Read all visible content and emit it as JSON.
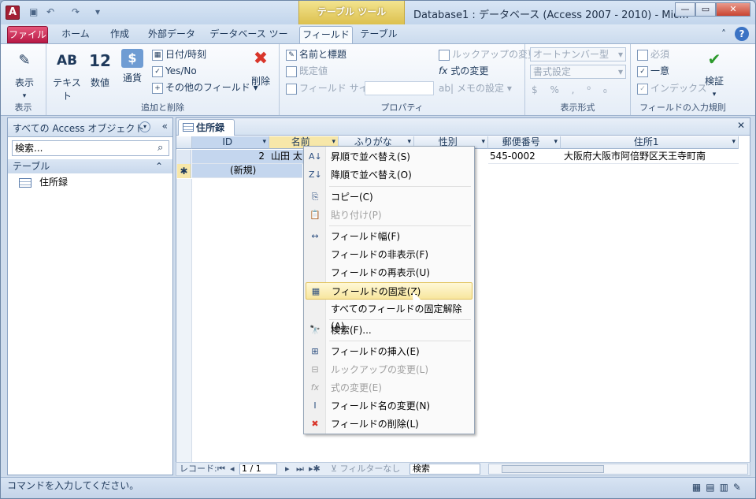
{
  "title": "Database1 : データベース (Access 2007 - 2010)  -  Mic...",
  "app_icon": "A",
  "context_tools": "テーブル ツール",
  "tabs": [
    "ファイル",
    "ホーム",
    "作成",
    "外部データ",
    "データベース ツール",
    "フィールド",
    "テーブル"
  ],
  "ribbon": {
    "view_label": "表示",
    "group_view": "表示",
    "text_label": "テキスト",
    "number_label": "数値",
    "currency_label": "通貨",
    "date_label": "日付/時刻",
    "yesno_label": "Yes/No",
    "more_fields": "その他のフィールド",
    "delete_label": "削除",
    "group_add": "追加と削除",
    "name_caption": "名前と標題",
    "default_value": "既定値",
    "field_size": "フィールド サイズ",
    "lookup_modify": "ルックアップの変更",
    "expr_modify": "式の変更",
    "memo_settings": "メモの設定",
    "group_props": "プロパティ",
    "datatype_value": "オートナンバー型",
    "format_value": "書式設定",
    "group_format": "表示形式",
    "required": "必須",
    "unique": "一意",
    "indexed": "インデックス",
    "validate_label": "検証",
    "group_validation": "フィールドの入力規則"
  },
  "nav": {
    "header": "すべての Access オブジェクト",
    "search_placeholder": "検索...",
    "section": "テーブル",
    "item": "住所録"
  },
  "doc": {
    "tab": "住所録",
    "columns": [
      "ID",
      "名前",
      "ふりがな",
      "性別",
      "郵便番号",
      "住所1"
    ],
    "row1": {
      "id": "2",
      "name": "山田 太",
      "zip": "545-0002",
      "addr": "大阪府大阪市阿倍野区天王寺町南"
    },
    "newrow": "(新規)"
  },
  "menu": [
    {
      "label": "昇順で並べ替え(S)",
      "icon": "A↓"
    },
    {
      "label": "降順で並べ替え(O)",
      "icon": "Z↓"
    },
    {
      "label": "コピー(C)",
      "icon": "⎘"
    },
    {
      "label": "貼り付け(P)",
      "icon": "📋"
    },
    {
      "label": "フィールド幅(F)",
      "icon": "↔"
    },
    {
      "label": "フィールドの非表示(F)",
      "icon": ""
    },
    {
      "label": "フィールドの再表示(U)",
      "icon": ""
    },
    {
      "label": "フィールドの固定(Z)",
      "icon": "▦"
    },
    {
      "label": "すべてのフィールドの固定解除(A)",
      "icon": ""
    },
    {
      "label": "検索(F)...",
      "icon": "🔭"
    },
    {
      "label": "フィールドの挿入(E)",
      "icon": "⊞"
    },
    {
      "label": "ルックアップの変更(L)",
      "icon": "⊟"
    },
    {
      "label": "式の変更(E)",
      "icon": "fx"
    },
    {
      "label": "フィールド名の変更(N)",
      "icon": "I"
    },
    {
      "label": "フィールドの削除(L)",
      "icon": "✖"
    }
  ],
  "recbar": {
    "label": "レコード:",
    "position": "1 / 1",
    "filter": "フィルターなし",
    "search": "検索"
  },
  "status": "コマンドを入力してください。"
}
